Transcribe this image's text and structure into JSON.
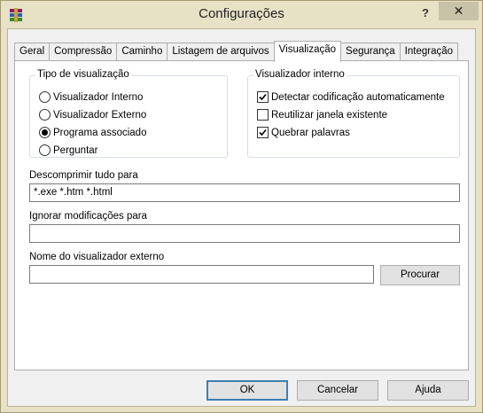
{
  "window": {
    "title": "Configurações",
    "help_glyph": "?",
    "close_glyph": "✕",
    "icon": "winrar-app-icon"
  },
  "tabs": [
    {
      "label": "Geral"
    },
    {
      "label": "Compressão"
    },
    {
      "label": "Caminho"
    },
    {
      "label": "Listagem de arquivos"
    },
    {
      "label": "Visualização"
    },
    {
      "label": "Segurança"
    },
    {
      "label": "Integração"
    }
  ],
  "active_tab": "Visualização",
  "view_type": {
    "label": "Tipo de visualização",
    "options": [
      {
        "label": "Visualizador Interno",
        "selected": false
      },
      {
        "label": "Visualizador Externo",
        "selected": false
      },
      {
        "label": "Programa associado",
        "selected": true
      },
      {
        "label": "Perguntar",
        "selected": false
      }
    ]
  },
  "internal_viewer": {
    "label": "Visualizador interno",
    "options": [
      {
        "label": "Detectar codificação automaticamente",
        "checked": true
      },
      {
        "label": "Reutilizar janela existente",
        "checked": false
      },
      {
        "label": "Quebrar palavras",
        "checked": true
      }
    ]
  },
  "fields": {
    "unpack_all_label": "Descomprimir tudo para",
    "unpack_all_value": "*.exe *.htm *.html",
    "ignore_mods_label": "Ignorar modificações para",
    "ignore_mods_value": "",
    "external_viewer_label": "Nome do visualizador externo",
    "external_viewer_value": "",
    "browse_label": "Procurar"
  },
  "footer": {
    "ok_label": "OK",
    "cancel_label": "Cancelar",
    "help_label": "Ajuda"
  }
}
